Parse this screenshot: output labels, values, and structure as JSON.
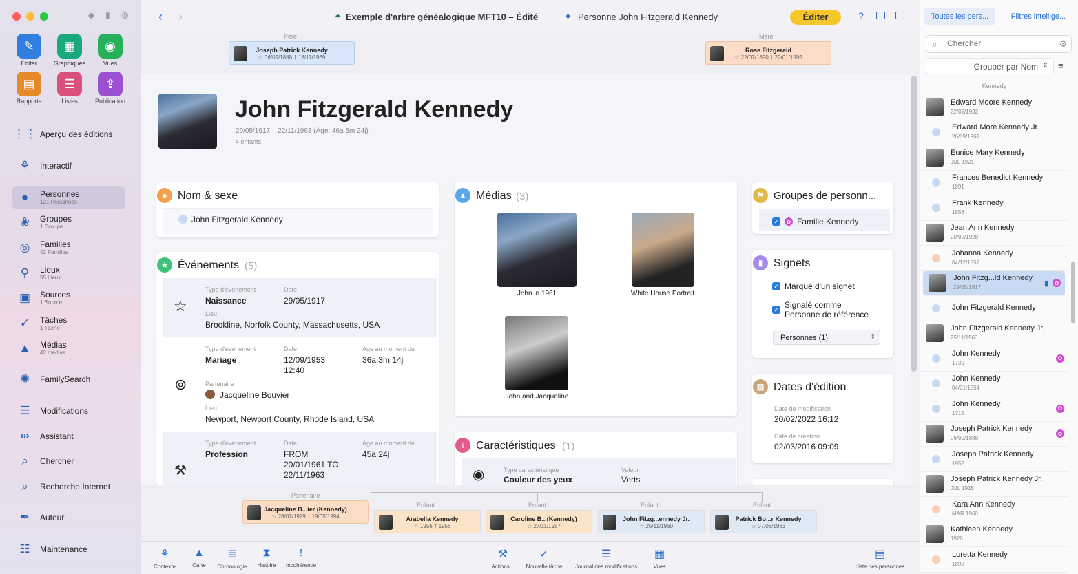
{
  "window": {
    "title": "Exemple d'arbre généalogique MFT10 – Édité",
    "person_tab": "Personne John Fitzgerald Kennedy",
    "edit_button": "Éditer"
  },
  "toolbar": {
    "tools": [
      {
        "label": "Éditer",
        "color": "#2f7ee0",
        "icon": "pencil-icon"
      },
      {
        "label": "Graphiques",
        "color": "#19a97c",
        "icon": "chart-icon"
      },
      {
        "label": "Vues",
        "color": "#27b05a",
        "icon": "eye-icon"
      },
      {
        "label": "Rapports",
        "color": "#e58a2b",
        "icon": "report-icon"
      },
      {
        "label": "Listes",
        "color": "#d9507a",
        "icon": "list-icon"
      },
      {
        "label": "Publication",
        "color": "#9b4fd1",
        "icon": "publish-icon"
      }
    ]
  },
  "sidebar": {
    "items": [
      {
        "label": "Aperçu des éditions",
        "sub": "",
        "icon": "grid-icon"
      },
      {
        "label": "Interactif",
        "sub": "",
        "icon": "tree-icon"
      },
      {
        "label": "Personnes",
        "sub": "121 Personnes",
        "icon": "person-icon"
      },
      {
        "label": "Groupes",
        "sub": "1 Groupe",
        "icon": "group-icon"
      },
      {
        "label": "Familles",
        "sub": "42 Familles",
        "icon": "rings-icon"
      },
      {
        "label": "Lieux",
        "sub": "55 Lieux",
        "icon": "pin-icon"
      },
      {
        "label": "Sources",
        "sub": "1 Source",
        "icon": "sources-icon"
      },
      {
        "label": "Tâches",
        "sub": "1 Tâche",
        "icon": "check-icon"
      },
      {
        "label": "Médias",
        "sub": "42 médias",
        "icon": "media-icon"
      },
      {
        "label": "FamilySearch",
        "sub": "",
        "icon": "familysearch-icon"
      },
      {
        "label": "Modifications",
        "sub": "",
        "icon": "changes-icon"
      },
      {
        "label": "Assistant",
        "sub": "",
        "icon": "assistant-icon"
      },
      {
        "label": "Chercher",
        "sub": "",
        "icon": "search-icon"
      },
      {
        "label": "Recherche Internet",
        "sub": "",
        "icon": "web-search-icon"
      },
      {
        "label": "Auteur",
        "sub": "",
        "icon": "author-icon"
      },
      {
        "label": "Maintenance",
        "sub": "",
        "icon": "maintenance-icon"
      }
    ]
  },
  "parents": {
    "father_label": "Père",
    "father_name": "Joseph Patrick Kennedy",
    "father_dates": "☆ 06/09/1888  † 18/11/1969",
    "mother_label": "Mère",
    "mother_name": "Rose Fitzgerald",
    "mother_dates": "☆ 22/07/1890  † 22/01/1995"
  },
  "person": {
    "name": "John Fitzgerald Kennedy",
    "dates": "29/05/1917 – 22/11/1963 (Âge: 46a 5m 24j)",
    "children": "4 enfants"
  },
  "name_sex": {
    "title": "Nom & sexe",
    "value": "John Fitzgerald Kennedy"
  },
  "events": {
    "title": "Événements",
    "count": "(5)",
    "type_label": "Type d'événement",
    "date_label": "Date",
    "place_label": "Lieu",
    "age_label": "Âge au moment de l",
    "partner_label": "Partenaire",
    "birth": {
      "type": "Naissance",
      "date": "29/05/1917",
      "place": "Brookline, Norfolk County, Massachusetts, USA"
    },
    "marriage": {
      "type": "Mariage",
      "date": "12/09/1953",
      "time": "12:40",
      "age": "36a 3m 14j",
      "partner": "Jacqueline Bouvier",
      "place": "Newport, Newport County, Rhode Island, USA"
    },
    "profession": {
      "type": "Profession",
      "date1": "FROM",
      "date2": "20/01/1961 TO",
      "date3": "22/11/1963",
      "age": "45a 24j"
    }
  },
  "medias": {
    "title": "Médias",
    "count": "(3)",
    "items": [
      "John in 1961",
      "White House Portrait",
      "John and Jacqueline"
    ]
  },
  "characteristics": {
    "title": "Caractéristiques",
    "count": "(1)",
    "type_label": "Type caractéristique",
    "type": "Couleur des yeux",
    "value_label": "Valeur",
    "value": "Verts"
  },
  "groups": {
    "title": "Groupes de personn...",
    "item": "Famille Kennedy"
  },
  "bookmarks": {
    "title": "Signets",
    "bookmarked": "Marqué d'un signet",
    "reference_line1": "Signalé comme",
    "reference_line2": "Personne de référence",
    "select": "Personnes (1)"
  },
  "edit_dates": {
    "title": "Dates d'édition",
    "modified_label": "Date de modification",
    "modified": "20/02/2022 16:12",
    "created_label": "Date de création",
    "created": "02/03/2016 09:09"
  },
  "family": {
    "partner_label": "Partenaire",
    "partner_name": "Jacqueline B...ier (Kennedy)",
    "partner_dates": "☆ 28/07/1929  † 19/05/1994",
    "child_label": "Enfant",
    "children": [
      {
        "name": "Arabella Kennedy",
        "dates": "☆ 1956  † 1956",
        "color": "#fbe3c8"
      },
      {
        "name": "Caroline B...(Kennedy)",
        "dates": "☆ 27/11/1957",
        "color": "#fbe3c8"
      },
      {
        "name": "John Fitzg...ennedy Jr.",
        "dates": "☆ 25/11/1960",
        "color": "#dfe8f5"
      },
      {
        "name": "Patrick Bo...r Kennedy",
        "dates": "☆ 07/08/1963",
        "color": "#dfe8f5"
      }
    ]
  },
  "bottom_toolbar": {
    "left": [
      {
        "label": "Contexte",
        "icon": "context-icon"
      },
      {
        "label": "Carte",
        "icon": "map-icon"
      },
      {
        "label": "Chronologie",
        "icon": "timeline-icon"
      },
      {
        "label": "Histoire",
        "icon": "story-icon"
      },
      {
        "label": "Incohérence",
        "icon": "warning-icon"
      }
    ],
    "right": [
      {
        "label": "Actions...",
        "icon": "actions-icon"
      },
      {
        "label": "Nouvelle tâche",
        "icon": "task-icon"
      },
      {
        "label": "Journal des modifications",
        "icon": "log-icon"
      },
      {
        "label": "Vues",
        "icon": "views-icon"
      }
    ],
    "person_list": "Liste des personnes"
  },
  "right_panel": {
    "tab_all": "Toutes les pers...",
    "tab_smart": "Filtres intellige...",
    "search_placeholder": "Chercher",
    "group_by": "Grouper par Nom",
    "group_header": "Kennedy",
    "people": [
      {
        "name": "Edward Moore Kennedy",
        "date": "22/02/1932",
        "avatar": "photo",
        "badge": ""
      },
      {
        "name": "Edward More Kennedy Jr.",
        "date": "26/09/1961",
        "avatar": "blue",
        "badge": ""
      },
      {
        "name": "Eunice Mary Kennedy",
        "date": "JUL 1921",
        "avatar": "photo",
        "badge": ""
      },
      {
        "name": "Frances Benedict Kennedy",
        "date": "1891",
        "avatar": "blue",
        "badge": ""
      },
      {
        "name": "Frank Kennedy",
        "date": "1856",
        "avatar": "blue",
        "badge": ""
      },
      {
        "name": "Jean Ann Kennedy",
        "date": "20/02/1928",
        "avatar": "photo",
        "badge": ""
      },
      {
        "name": "Johanna Kennedy",
        "date": "04/12/1852",
        "avatar": "peach",
        "badge": ""
      },
      {
        "name": "John Fitzg...ld Kennedy",
        "date": "29/05/1917",
        "avatar": "photo",
        "badge": "selected"
      },
      {
        "name": "John Fitzgerald Kennedy",
        "date": "",
        "avatar": "blue",
        "badge": ""
      },
      {
        "name": "John Fitzgerald Kennedy Jr.",
        "date": "25/11/1960",
        "avatar": "photo",
        "badge": ""
      },
      {
        "name": "John Kennedy",
        "date": "1739",
        "avatar": "blue",
        "badge": "pink"
      },
      {
        "name": "John Kennedy",
        "date": "04/01/1854",
        "avatar": "blue",
        "badge": ""
      },
      {
        "name": "John Kennedy",
        "date": "1715",
        "avatar": "blue",
        "badge": "pink"
      },
      {
        "name": "Joseph Patrick Kennedy",
        "date": "06/09/1888",
        "avatar": "photo",
        "badge": "pink"
      },
      {
        "name": "Joseph Patrick Kennedy",
        "date": "1952",
        "avatar": "blue",
        "badge": ""
      },
      {
        "name": "Joseph Patrick Kennedy Jr.",
        "date": "JUL 1915",
        "avatar": "photo",
        "badge": ""
      },
      {
        "name": "Kara Ann Kennedy",
        "date": "MAR 1960",
        "avatar": "peach",
        "badge": ""
      },
      {
        "name": "Kathleen Kennedy",
        "date": "1920",
        "avatar": "photo",
        "badge": ""
      },
      {
        "name": "Loretta Kennedy",
        "date": "1892",
        "avatar": "peach",
        "badge": ""
      }
    ]
  }
}
